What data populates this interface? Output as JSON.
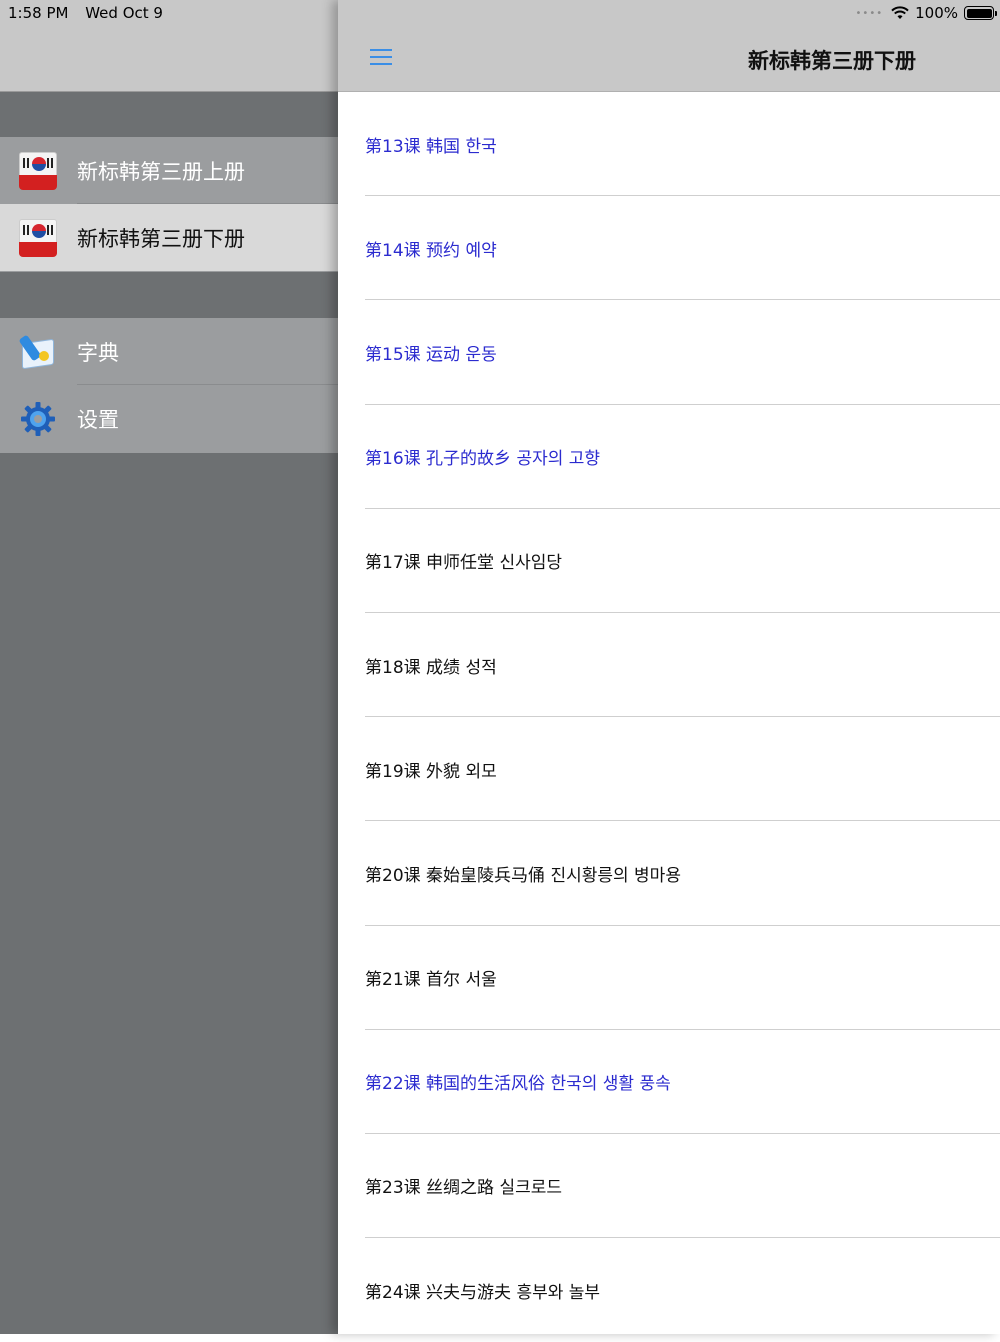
{
  "status_bar": {
    "time": "1:58 PM",
    "date": "Wed Oct 9",
    "battery": "100%"
  },
  "sidebar": {
    "books": [
      {
        "label": "新标韩第三册上册",
        "icon": "korean-flag-book-icon",
        "selected": false
      },
      {
        "label": "新标韩第三册下册",
        "icon": "korean-flag-book-icon",
        "selected": true
      }
    ],
    "tools": [
      {
        "label": "字典",
        "icon": "dictionary-icon"
      },
      {
        "label": "设置",
        "icon": "gear-icon"
      }
    ]
  },
  "nav": {
    "title": "新标韩第三册下册",
    "menu_icon": "hamburger-menu-icon"
  },
  "colors": {
    "accent": "#3a8ee6",
    "highlight_text": "#2b2bcf"
  },
  "lessons": [
    {
      "label": "第13课 韩国 한국",
      "highlighted": true
    },
    {
      "label": "第14课 预约 예약",
      "highlighted": true
    },
    {
      "label": "第15课 运动 운동",
      "highlighted": true
    },
    {
      "label": "第16课 孔子的故乡 공자의 고향",
      "highlighted": true
    },
    {
      "label": "第17课 申师任堂 신사임당",
      "highlighted": false
    },
    {
      "label": "第18课 成绩 성적",
      "highlighted": false
    },
    {
      "label": "第19课 外貌 외모",
      "highlighted": false
    },
    {
      "label": "第20课 秦始皇陵兵马俑 진시황릉의 병마용",
      "highlighted": false
    },
    {
      "label": "第21课 首尔 서울",
      "highlighted": false
    },
    {
      "label": "第22课 韩国的生活风俗 한국의 생활 풍속",
      "highlighted": true
    },
    {
      "label": "第23课 丝绸之路 실크로드",
      "highlighted": false
    },
    {
      "label": "第24课 兴夫与游夫 흥부와 놀부",
      "highlighted": false
    }
  ]
}
